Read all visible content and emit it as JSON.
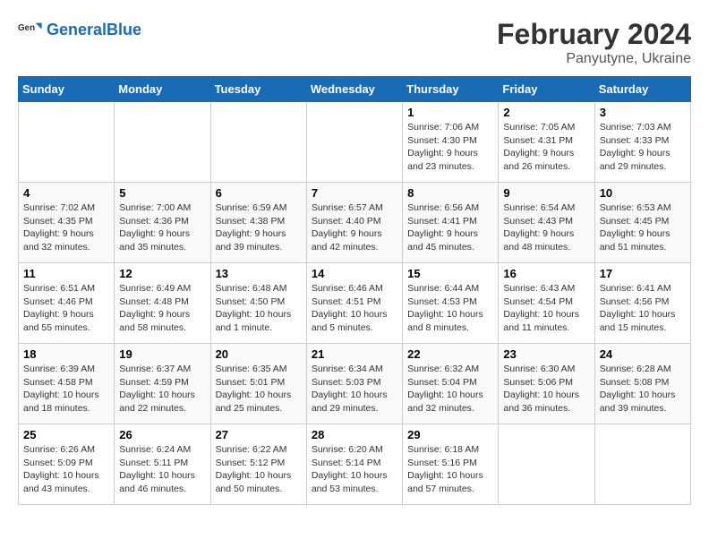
{
  "header": {
    "logo_general": "General",
    "logo_blue": "Blue",
    "month_year": "February 2024",
    "location": "Panyutyne, Ukraine"
  },
  "days_of_week": [
    "Sunday",
    "Monday",
    "Tuesday",
    "Wednesday",
    "Thursday",
    "Friday",
    "Saturday"
  ],
  "weeks": [
    [
      {
        "day": "",
        "info": ""
      },
      {
        "day": "",
        "info": ""
      },
      {
        "day": "",
        "info": ""
      },
      {
        "day": "",
        "info": ""
      },
      {
        "day": "1",
        "info": "Sunrise: 7:06 AM\nSunset: 4:30 PM\nDaylight: 9 hours\nand 23 minutes."
      },
      {
        "day": "2",
        "info": "Sunrise: 7:05 AM\nSunset: 4:31 PM\nDaylight: 9 hours\nand 26 minutes."
      },
      {
        "day": "3",
        "info": "Sunrise: 7:03 AM\nSunset: 4:33 PM\nDaylight: 9 hours\nand 29 minutes."
      }
    ],
    [
      {
        "day": "4",
        "info": "Sunrise: 7:02 AM\nSunset: 4:35 PM\nDaylight: 9 hours\nand 32 minutes."
      },
      {
        "day": "5",
        "info": "Sunrise: 7:00 AM\nSunset: 4:36 PM\nDaylight: 9 hours\nand 35 minutes."
      },
      {
        "day": "6",
        "info": "Sunrise: 6:59 AM\nSunset: 4:38 PM\nDaylight: 9 hours\nand 39 minutes."
      },
      {
        "day": "7",
        "info": "Sunrise: 6:57 AM\nSunset: 4:40 PM\nDaylight: 9 hours\nand 42 minutes."
      },
      {
        "day": "8",
        "info": "Sunrise: 6:56 AM\nSunset: 4:41 PM\nDaylight: 9 hours\nand 45 minutes."
      },
      {
        "day": "9",
        "info": "Sunrise: 6:54 AM\nSunset: 4:43 PM\nDaylight: 9 hours\nand 48 minutes."
      },
      {
        "day": "10",
        "info": "Sunrise: 6:53 AM\nSunset: 4:45 PM\nDaylight: 9 hours\nand 51 minutes."
      }
    ],
    [
      {
        "day": "11",
        "info": "Sunrise: 6:51 AM\nSunset: 4:46 PM\nDaylight: 9 hours\nand 55 minutes."
      },
      {
        "day": "12",
        "info": "Sunrise: 6:49 AM\nSunset: 4:48 PM\nDaylight: 9 hours\nand 58 minutes."
      },
      {
        "day": "13",
        "info": "Sunrise: 6:48 AM\nSunset: 4:50 PM\nDaylight: 10 hours\nand 1 minute."
      },
      {
        "day": "14",
        "info": "Sunrise: 6:46 AM\nSunset: 4:51 PM\nDaylight: 10 hours\nand 5 minutes."
      },
      {
        "day": "15",
        "info": "Sunrise: 6:44 AM\nSunset: 4:53 PM\nDaylight: 10 hours\nand 8 minutes."
      },
      {
        "day": "16",
        "info": "Sunrise: 6:43 AM\nSunset: 4:54 PM\nDaylight: 10 hours\nand 11 minutes."
      },
      {
        "day": "17",
        "info": "Sunrise: 6:41 AM\nSunset: 4:56 PM\nDaylight: 10 hours\nand 15 minutes."
      }
    ],
    [
      {
        "day": "18",
        "info": "Sunrise: 6:39 AM\nSunset: 4:58 PM\nDaylight: 10 hours\nand 18 minutes."
      },
      {
        "day": "19",
        "info": "Sunrise: 6:37 AM\nSunset: 4:59 PM\nDaylight: 10 hours\nand 22 minutes."
      },
      {
        "day": "20",
        "info": "Sunrise: 6:35 AM\nSunset: 5:01 PM\nDaylight: 10 hours\nand 25 minutes."
      },
      {
        "day": "21",
        "info": "Sunrise: 6:34 AM\nSunset: 5:03 PM\nDaylight: 10 hours\nand 29 minutes."
      },
      {
        "day": "22",
        "info": "Sunrise: 6:32 AM\nSunset: 5:04 PM\nDaylight: 10 hours\nand 32 minutes."
      },
      {
        "day": "23",
        "info": "Sunrise: 6:30 AM\nSunset: 5:06 PM\nDaylight: 10 hours\nand 36 minutes."
      },
      {
        "day": "24",
        "info": "Sunrise: 6:28 AM\nSunset: 5:08 PM\nDaylight: 10 hours\nand 39 minutes."
      }
    ],
    [
      {
        "day": "25",
        "info": "Sunrise: 6:26 AM\nSunset: 5:09 PM\nDaylight: 10 hours\nand 43 minutes."
      },
      {
        "day": "26",
        "info": "Sunrise: 6:24 AM\nSunset: 5:11 PM\nDaylight: 10 hours\nand 46 minutes."
      },
      {
        "day": "27",
        "info": "Sunrise: 6:22 AM\nSunset: 5:12 PM\nDaylight: 10 hours\nand 50 minutes."
      },
      {
        "day": "28",
        "info": "Sunrise: 6:20 AM\nSunset: 5:14 PM\nDaylight: 10 hours\nand 53 minutes."
      },
      {
        "day": "29",
        "info": "Sunrise: 6:18 AM\nSunset: 5:16 PM\nDaylight: 10 hours\nand 57 minutes."
      },
      {
        "day": "",
        "info": ""
      },
      {
        "day": "",
        "info": ""
      }
    ]
  ]
}
